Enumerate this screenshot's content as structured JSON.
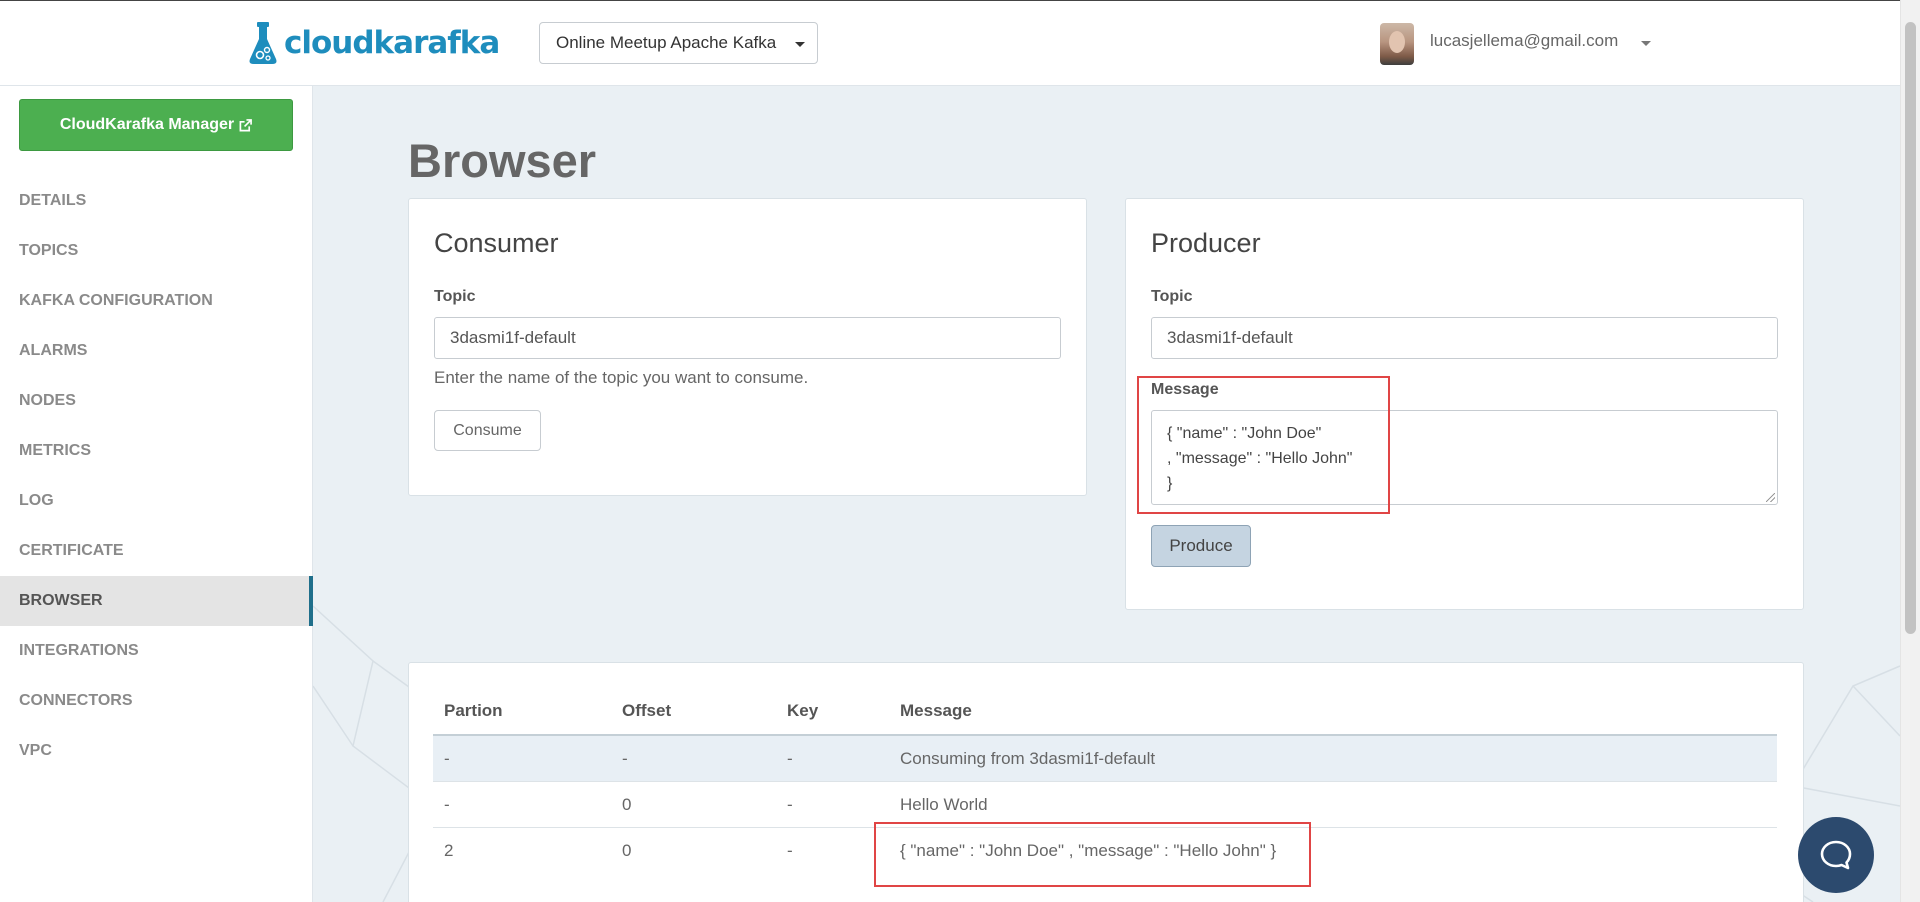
{
  "header": {
    "logo_text": "cloudkarafka",
    "instance_label": "Online Meetup Apache Kafka",
    "user_email": "lucasjellema@gmail.com"
  },
  "sidebar": {
    "manager_button": "CloudKarafka Manager",
    "items": [
      {
        "label": "DETAILS"
      },
      {
        "label": "TOPICS"
      },
      {
        "label": "KAFKA CONFIGURATION"
      },
      {
        "label": "ALARMS"
      },
      {
        "label": "NODES"
      },
      {
        "label": "METRICS"
      },
      {
        "label": "LOG"
      },
      {
        "label": "CERTIFICATE"
      },
      {
        "label": "BROWSER"
      },
      {
        "label": "INTEGRATIONS"
      },
      {
        "label": "CONNECTORS"
      },
      {
        "label": "VPC"
      }
    ]
  },
  "page": {
    "title": "Browser"
  },
  "consumer": {
    "title": "Consumer",
    "topic_label": "Topic",
    "topic_value": "3dasmi1f-default",
    "hint": "Enter the name of the topic you want to consume.",
    "button": "Consume"
  },
  "producer": {
    "title": "Producer",
    "topic_label": "Topic",
    "topic_value": "3dasmi1f-default",
    "message_label": "Message",
    "message_value": "{ \"name\" : \"John Doe\"\n, \"message\" : \"Hello John\"\n}",
    "button": "Produce"
  },
  "messages_table": {
    "headers": [
      "Partion",
      "Offset",
      "Key",
      "Message"
    ],
    "rows": [
      [
        "-",
        "-",
        "-",
        "Consuming from 3dasmi1f-default"
      ],
      [
        "-",
        "0",
        "-",
        "Hello World"
      ],
      [
        "2",
        "0",
        "-",
        "{ \"name\" : \"John Doe\" , \"message\" : \"Hello John\" }"
      ]
    ]
  },
  "colors": {
    "brand": "#1e8dbd",
    "manager_button": "#4caf50",
    "active_nav_marker": "#1f6f8b",
    "annotation_box": "#e04545",
    "chat_button": "#2c4a6e"
  },
  "icons": [
    "flask-logo-icon",
    "external-link-icon",
    "chevron-down-icon",
    "chat-bubble-icon"
  ]
}
